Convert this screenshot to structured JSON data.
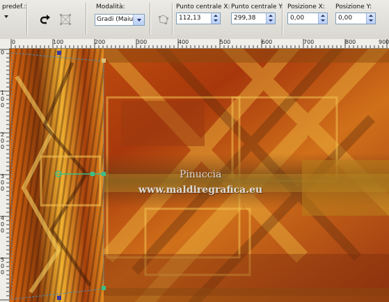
{
  "toolbar": {
    "preset_label": "predef.:",
    "mode_label": "Modalità:",
    "mode_value": "Gradi (Maiu:",
    "center_x_label": "Punto centrale X:",
    "center_x_value": "112,13",
    "center_y_label": "Punto centrale Y:",
    "center_y_value": "299,38",
    "pos_x_label": "Posizione X:",
    "pos_x_value": "0,00",
    "pos_y_label": "Posizione Y:",
    "pos_y_value": "0,00",
    "icons": [
      "reset-arrow-icon",
      "deform-mode-icon",
      "edit-nodes-icon"
    ]
  },
  "ruler_top": [
    "0",
    "100",
    "200",
    "300",
    "400",
    "500",
    "600",
    "700",
    "800",
    "900"
  ],
  "ruler_left": [
    "0",
    "1\n0\n0",
    "2\n0\n0",
    "3\n0\n0",
    "4\n0\n0",
    "5\n0\n0"
  ],
  "watermark": {
    "line1": "Pinuccia",
    "line2": "www.maldiregrafica.eu"
  },
  "colors": {
    "canvas_base": "#b8460f",
    "gold": "#e0a020",
    "dark": "#4a2a10",
    "handle": "#3cbf86"
  }
}
